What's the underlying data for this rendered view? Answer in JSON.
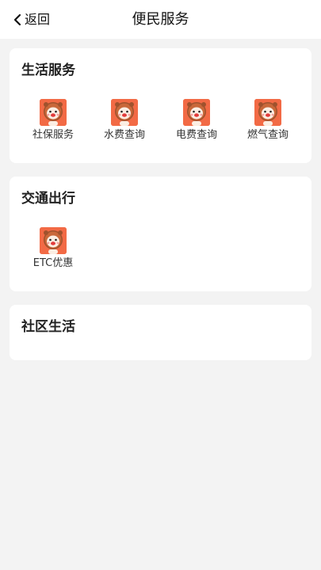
{
  "header": {
    "back_label": "返回",
    "title": "便民服务"
  },
  "sections": [
    {
      "title": "生活服务",
      "items": [
        {
          "label": "社保服务",
          "icon": "lion-icon"
        },
        {
          "label": "水费查询",
          "icon": "lion-icon"
        },
        {
          "label": "电费查询",
          "icon": "lion-icon"
        },
        {
          "label": "燃气查询",
          "icon": "lion-icon"
        }
      ]
    },
    {
      "title": "交通出行",
      "items": [
        {
          "label": "ETC优惠",
          "icon": "lion-icon"
        }
      ]
    },
    {
      "title": "社区生活",
      "items": []
    }
  ],
  "colors": {
    "background": "#f3f3f3",
    "card": "#ffffff",
    "icon_bg": "#f26a45"
  }
}
